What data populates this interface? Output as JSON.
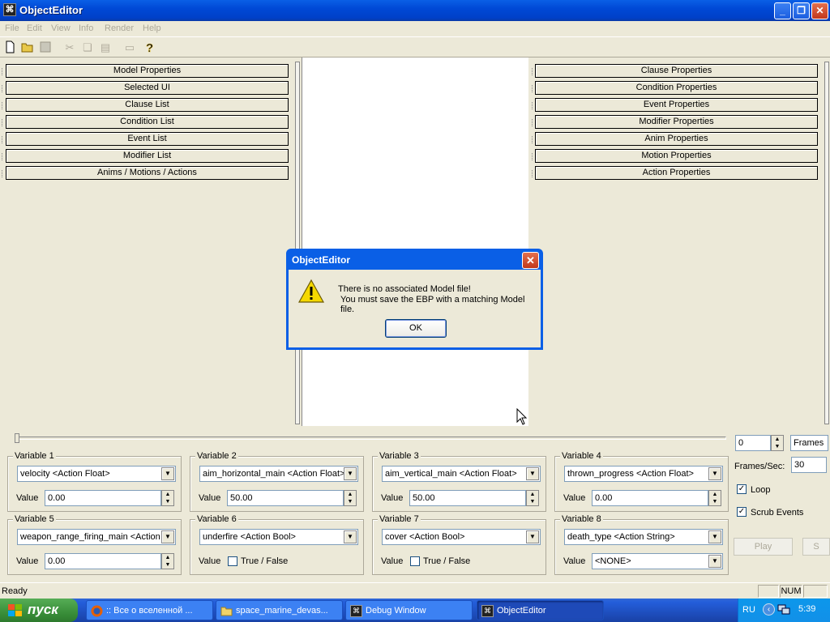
{
  "window": {
    "title": "ObjectEditor",
    "icon": "object-editor-icon"
  },
  "title_buttons": {
    "minimize": "_",
    "restore": "❐",
    "close": "✕"
  },
  "menu": [
    "File",
    "Edit",
    "View",
    "Info",
    "Render",
    "Help"
  ],
  "toolbar": [
    "new-file-icon",
    "open-folder-icon",
    "save-icon",
    "cut-icon",
    "copy-icon",
    "paste-icon",
    "print-icon",
    "help-icon"
  ],
  "left_panel": {
    "items": [
      "Model Properties",
      "Selected UI",
      "Clause List",
      "Condition List",
      "Event List",
      "Modifier List",
      "Anims / Motions / Actions"
    ]
  },
  "right_panel": {
    "items": [
      "Clause Properties",
      "Condition Properties",
      "Event Properties",
      "Modifier Properties",
      "Anim Properties",
      "Motion Properties",
      "Action Properties"
    ]
  },
  "dialog": {
    "title": "ObjectEditor",
    "line1": "There is no associated Model file!",
    "line2": "You must save the EBP with a matching Model file.",
    "ok": "OK",
    "icon": "warning-icon"
  },
  "variables": [
    {
      "label": "Variable 1",
      "combo": "velocity <Action Float>",
      "value_label": "Value",
      "value": "0.00",
      "kind": "float"
    },
    {
      "label": "Variable 2",
      "combo": "aim_horizontal_main <Action Float>",
      "value_label": "Value",
      "value": "50.00",
      "kind": "float"
    },
    {
      "label": "Variable 3",
      "combo": "aim_vertical_main <Action Float>",
      "value_label": "Value",
      "value": "50.00",
      "kind": "float"
    },
    {
      "label": "Variable 4",
      "combo": "thrown_progress <Action Float>",
      "value_label": "Value",
      "value": "0.00",
      "kind": "float"
    },
    {
      "label": "Variable 5",
      "combo": "weapon_range_firing_main <Action",
      "value_label": "Value",
      "value": "0.00",
      "kind": "float"
    },
    {
      "label": "Variable 6",
      "combo": "underfire <Action Bool>",
      "value_label": "Value",
      "value": "True / False",
      "kind": "bool"
    },
    {
      "label": "Variable 7",
      "combo": "cover <Action Bool>",
      "value_label": "Value",
      "value": "True / False",
      "kind": "bool"
    },
    {
      "label": "Variable 8",
      "combo": "death_type <Action String>",
      "value_label": "Value",
      "value": "<NONE>",
      "kind": "string"
    }
  ],
  "playback": {
    "frame": "0",
    "unit": "Frames",
    "fps_label": "Frames/Sec:",
    "fps": "30",
    "loop_label": "Loop",
    "scrub_label": "Scrub Events",
    "play": "Play",
    "stop": "S"
  },
  "status": {
    "text": "Ready",
    "num": "NUM"
  },
  "taskbar": {
    "start": "пуск",
    "tasks": [
      {
        "label": ":: Все о вселенной ...",
        "icon": "firefox-icon"
      },
      {
        "label": "space_marine_devas...",
        "icon": "folder-icon"
      },
      {
        "label": "Debug Window",
        "icon": "object-editor-icon"
      },
      {
        "label": "ObjectEditor",
        "icon": "object-editor-icon"
      }
    ],
    "lang": "RU",
    "clock": "5:39"
  }
}
